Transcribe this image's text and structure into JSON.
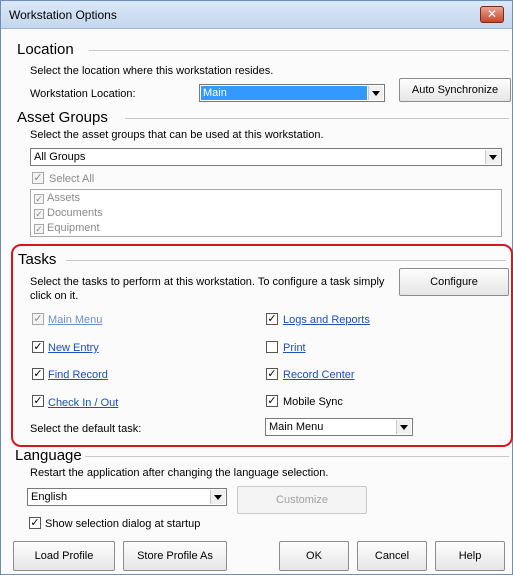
{
  "window": {
    "title": "Workstation Options",
    "close_glyph": "✕"
  },
  "location": {
    "heading": "Location",
    "description": "Select the location where this workstation resides.",
    "field_label": "Workstation Location:",
    "value": "Main",
    "auto_sync_label": "Auto Synchronize"
  },
  "asset_groups": {
    "heading": "Asset Groups",
    "description": "Select the asset groups that can be used at this workstation.",
    "selected_group": "All Groups",
    "select_all_label": "Select All",
    "items": [
      {
        "label": "Assets",
        "checked": true
      },
      {
        "label": "Documents",
        "checked": true
      },
      {
        "label": "Equipment",
        "checked": true
      }
    ]
  },
  "tasks": {
    "heading": "Tasks",
    "description": "Select the tasks to perform at this workstation. To configure a task simply click on it.",
    "configure_label": "Configure",
    "left": [
      {
        "label": "Main Menu",
        "checked": true,
        "disabled": true,
        "link": true
      },
      {
        "label": "New Entry",
        "checked": true,
        "disabled": false,
        "link": true
      },
      {
        "label": "Find Record",
        "checked": true,
        "disabled": false,
        "link": true
      },
      {
        "label": "Check In / Out",
        "checked": true,
        "disabled": false,
        "link": true
      }
    ],
    "right": [
      {
        "label": "Logs and Reports",
        "checked": true,
        "disabled": false,
        "link": true
      },
      {
        "label": "Print",
        "checked": false,
        "disabled": false,
        "link": true
      },
      {
        "label": "Record Center",
        "checked": true,
        "disabled": false,
        "link": true
      },
      {
        "label": "Mobile Sync",
        "checked": true,
        "disabled": false,
        "link": false
      }
    ],
    "default_label": "Select the default task:",
    "default_value": "Main Menu"
  },
  "language": {
    "heading": "Language",
    "description": "Restart the application after changing the language selection.",
    "value": "English",
    "customize_label": "Customize",
    "show_dialog_label": "Show selection dialog at startup",
    "show_dialog_checked": true
  },
  "footer": {
    "load_profile": "Load Profile",
    "store_profile": "Store Profile As",
    "ok": "OK",
    "cancel": "Cancel",
    "help": "Help"
  },
  "colors": {
    "highlight": "#d9141e",
    "link": "#1c4fb8",
    "selection": "#3399ff"
  }
}
